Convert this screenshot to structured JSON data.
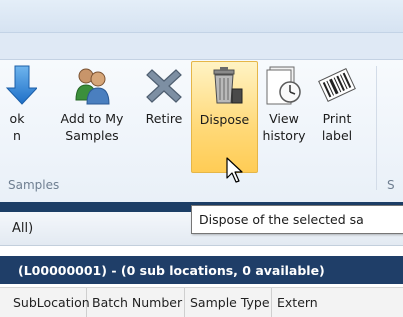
{
  "ribbon": {
    "buttons": [
      {
        "name": "partial-button",
        "line1": "ok",
        "line2": "n"
      },
      {
        "name": "add-to-my-samples-button",
        "line1": "Add to My",
        "line2": "Samples"
      },
      {
        "name": "retire-button",
        "line1": "Retire",
        "line2": ""
      },
      {
        "name": "dispose-button",
        "line1": "Dispose",
        "line2": ""
      },
      {
        "name": "view-history-button",
        "line1": "View",
        "line2": "history"
      },
      {
        "name": "print-label-button",
        "line1": "Print",
        "line2": "label"
      }
    ],
    "group_label": "Samples",
    "next_group_label_fragment": "S",
    "icons": {
      "partial": "blue-arrow-icon",
      "add_to_my_samples": "users-group-icon",
      "retire": "x-mark-icon",
      "dispose": "trash-can-icon",
      "view_history": "history-clock-icon",
      "print_label": "barcode-label-icon"
    },
    "highlight_color": "#ffd978"
  },
  "filter": {
    "text": "All)"
  },
  "tooltip": {
    "text": "Dispose of the selected sa"
  },
  "location_bar": {
    "text": "(L00000001)  -  (0 sub locations, 0 available)"
  },
  "table": {
    "columns": [
      "SubLocation",
      "Batch Number",
      "Sample Type",
      "Extern"
    ]
  },
  "colors": {
    "nav_dark": "#1f3e68",
    "ribbon_bg": "#eef3f9"
  }
}
